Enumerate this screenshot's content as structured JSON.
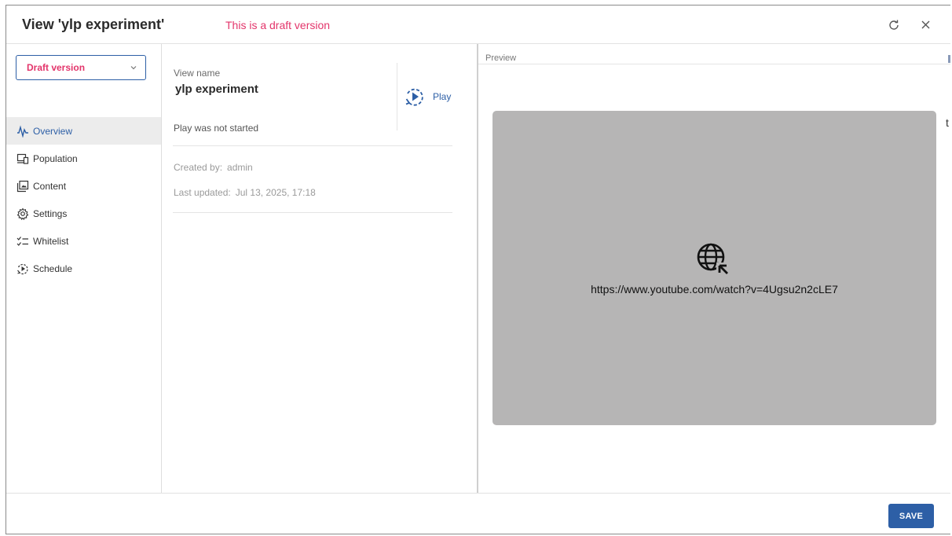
{
  "header": {
    "title": "View 'ylp experiment'",
    "draft_note": "This is a draft version",
    "refresh_icon": "refresh-icon",
    "close_icon": "close-icon"
  },
  "sidebar": {
    "version_select": {
      "value": "Draft version"
    },
    "items": [
      {
        "label": "Overview",
        "icon": "activity-icon",
        "active": true
      },
      {
        "label": "Population",
        "icon": "devices-icon",
        "active": false
      },
      {
        "label": "Content",
        "icon": "media-folder-icon",
        "active": false
      },
      {
        "label": "Settings",
        "icon": "gear-icon",
        "active": false
      },
      {
        "label": "Whitelist",
        "icon": "checklist-icon",
        "active": false
      },
      {
        "label": "Schedule",
        "icon": "schedule-play-icon",
        "active": false
      }
    ]
  },
  "overview": {
    "view_name_label": "View name",
    "view_name": "ylp experiment",
    "play_label": "Play",
    "play_status": "Play was not started",
    "created_by_label": "Created by:",
    "created_by": "admin",
    "last_updated_label": "Last updated:",
    "last_updated": "Jul 13, 2025, 17:18"
  },
  "preview": {
    "label": "Preview",
    "url": "https://www.youtube.com/watch?v=4Ugsu2n2cLE7",
    "edge_char": "t"
  },
  "footer": {
    "save_label": "SAVE"
  },
  "colors": {
    "accent": "#2d5fa6",
    "draft": "#e3356b",
    "preview_bg": "#b6b5b5"
  }
}
